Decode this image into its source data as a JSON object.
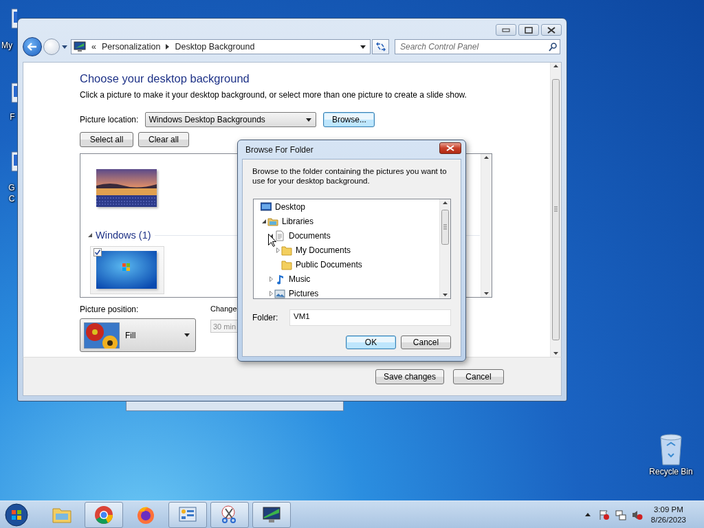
{
  "desktop_icons": [
    {
      "label": "My"
    },
    {
      "label": "F"
    },
    {
      "label": "G C"
    }
  ],
  "recycle_bin": {
    "label": "Recycle Bin"
  },
  "window": {
    "nav": {
      "overflow": "«",
      "breadcrumb": [
        "Personalization",
        "Desktop Background"
      ]
    },
    "search": {
      "placeholder": "Search Control Panel"
    },
    "heading": "Choose your desktop background",
    "description": "Click a picture to make it your desktop background, or select more than one picture to create a slide show.",
    "picture_location": {
      "label": "Picture location:",
      "value": "Windows Desktop Backgrounds"
    },
    "browse_button": {
      "label": "Browse...",
      "focused": true
    },
    "select_all": "Select all",
    "clear_all": "Clear all",
    "gallery": [
      {
        "kind": "landscape",
        "checked": false,
        "selected": false
      },
      {
        "kind": "group",
        "label": "Windows (1)",
        "expanded": true
      },
      {
        "kind": "wallpaper",
        "checked": true,
        "selected": true
      }
    ],
    "picture_position": {
      "label": "Picture position:",
      "value": "Fill"
    },
    "change_label": "Change",
    "interval": {
      "value": "30 min",
      "disabled": true
    },
    "buttons": [
      "Save changes",
      "Cancel"
    ]
  },
  "dialog": {
    "title": "Browse For Folder",
    "instructions": "Browse to the folder containing the pictures you want to use for your desktop background.",
    "tree": [
      {
        "kind": "desktop",
        "label": "Desktop",
        "children": [
          {
            "kind": "library",
            "label": "Libraries",
            "expanded": true,
            "children": [
              {
                "kind": "documents",
                "label": "Documents",
                "expanded": true,
                "children": [
                  {
                    "kind": "folder",
                    "label": "My Documents",
                    "expanded": false
                  },
                  {
                    "kind": "folder",
                    "label": "Public Documents"
                  }
                ]
              },
              {
                "kind": "music",
                "label": "Music",
                "expanded": false
              },
              {
                "kind": "pictures",
                "label": "Pictures",
                "expanded": false
              }
            ]
          }
        ]
      }
    ],
    "folder": {
      "label": "Folder:",
      "value": "VM1"
    },
    "buttons": [
      {
        "label": "OK",
        "default": true
      },
      {
        "label": "Cancel",
        "default": false
      }
    ]
  },
  "taskbar": {
    "apps": [
      {
        "kind": "explorer",
        "running": false
      },
      {
        "kind": "chrome",
        "running": true
      },
      {
        "kind": "firefox",
        "running": false
      },
      {
        "kind": "control",
        "running": true
      },
      {
        "kind": "snipping",
        "running": true
      },
      {
        "kind": "display",
        "running": true
      }
    ],
    "time": "3:09 PM",
    "date": "8/26/2023"
  }
}
